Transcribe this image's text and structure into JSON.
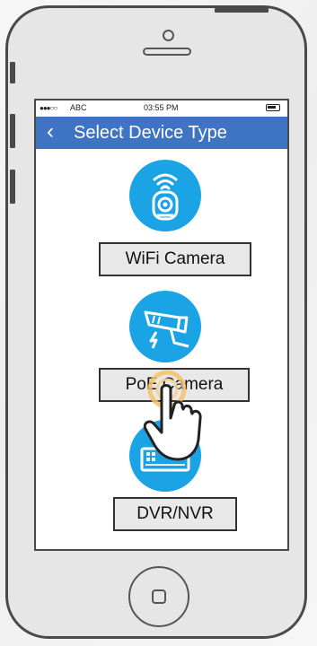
{
  "status": {
    "signal": "●●●○○",
    "carrier": "ABC",
    "time": "03:55 PM"
  },
  "nav": {
    "back_icon": "chevron-left-icon",
    "title": "Select Device Type"
  },
  "devices": [
    {
      "label": "WiFi Camera",
      "icon": "wifi-camera-icon"
    },
    {
      "label": "PoE Camera",
      "icon": "cctv-camera-icon"
    },
    {
      "label": "DVR/NVR",
      "icon": "dvr-recorder-icon"
    }
  ],
  "colors": {
    "nav_bar": "#3f74c4",
    "icon_circle": "#1aa3e5",
    "label_bg": "#e8e8e8",
    "tap_ring": "#f3c26b"
  }
}
